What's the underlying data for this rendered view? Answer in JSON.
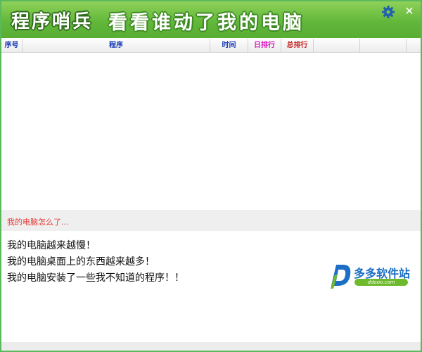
{
  "window": {
    "title": "程序哨兵",
    "slogan": "看看谁动了我的电脑",
    "settings_icon": "gear-icon",
    "close_icon": "close-icon",
    "close_glyph": "✕"
  },
  "table": {
    "columns": [
      {
        "label": "序号",
        "color": "#1a3db5"
      },
      {
        "label": "程序",
        "color": "#1a3db5"
      },
      {
        "label": "时间",
        "color": "#1a3db5"
      },
      {
        "label": "日排行",
        "color": "#d81bbf"
      },
      {
        "label": "总排行",
        "color": "#c62828"
      }
    ]
  },
  "info": {
    "section_title": "我的电脑怎么了...",
    "lines": [
      "我的电脑越来越慢！",
      "我的电脑桌面上的东西越来越多！",
      "我的电脑安装了一些我不知道的程序！！"
    ]
  },
  "watermark": {
    "logo_letter": "D",
    "name": "多多软件站",
    "url": "ddooo.com"
  },
  "colors": {
    "title_green": "#62b83a",
    "section_red": "#e53935",
    "accent_blue": "#1c6fc4"
  }
}
